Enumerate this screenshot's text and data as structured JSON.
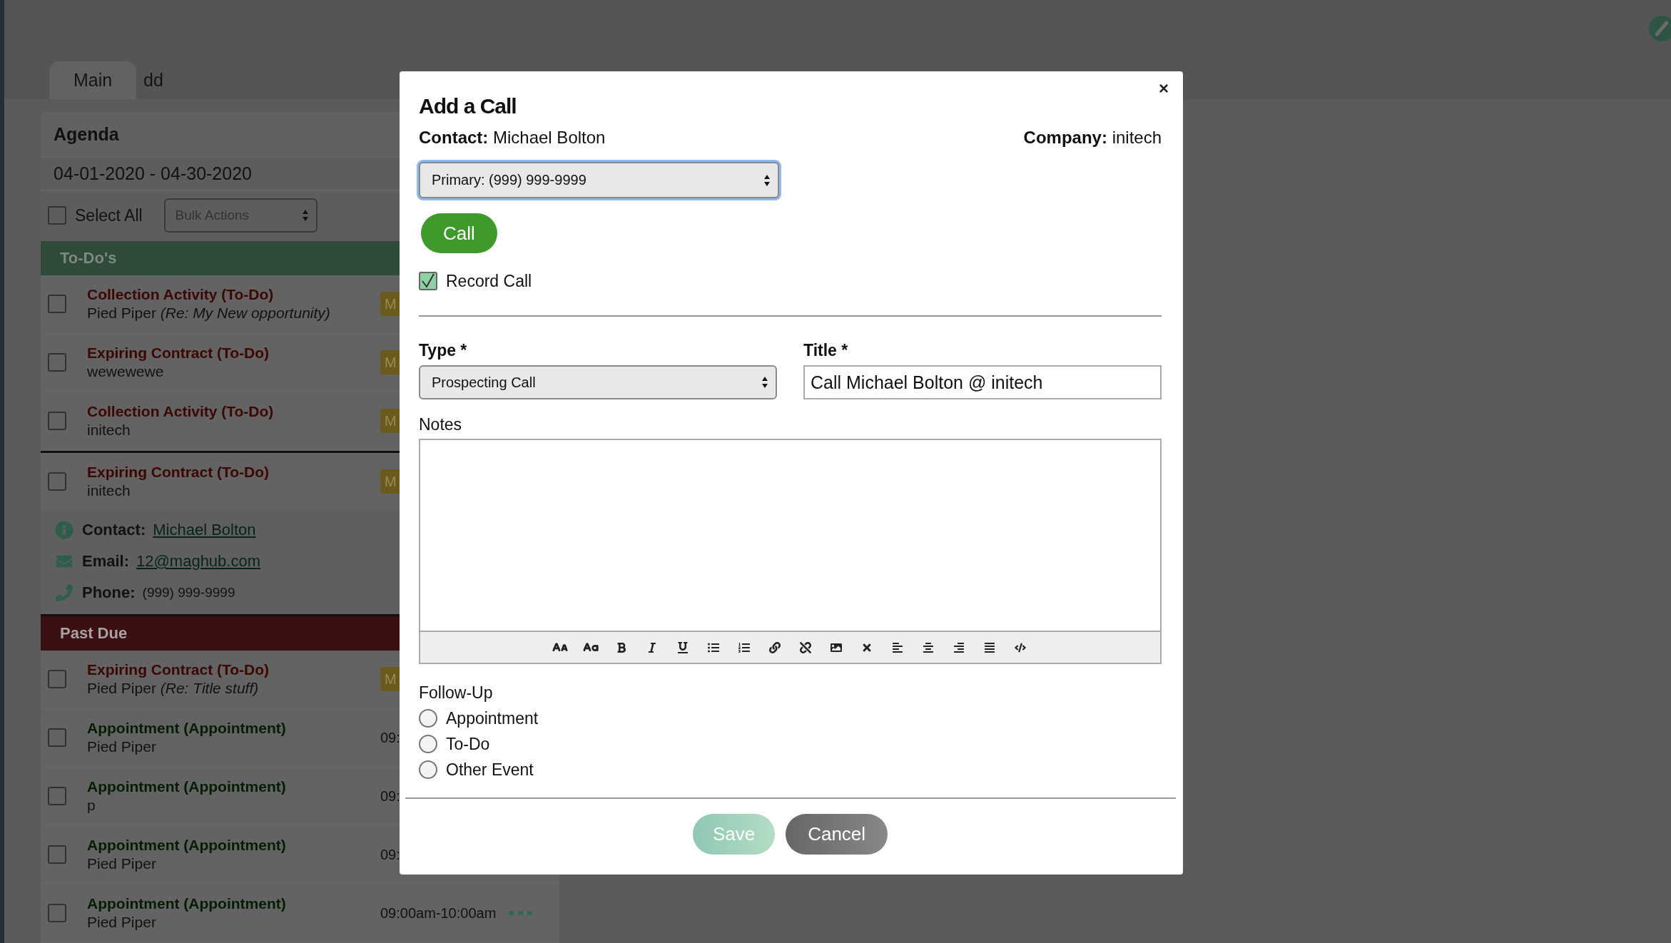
{
  "tabs": [
    {
      "label": "Main",
      "selected": true
    },
    {
      "label": "dd",
      "selected": false
    }
  ],
  "agenda": {
    "title": "Agenda",
    "date_range": "04-01-2020 - 04-30-2020",
    "select_all": {
      "label": "Select All",
      "checked": false
    },
    "bulk_actions": {
      "placeholder": "Bulk Actions"
    },
    "sections": [
      {
        "title": "To-Do's",
        "kind": "todo",
        "items": [
          {
            "title": "Collection Activity (To-Do)",
            "kind": "todo",
            "subtitle": "Pied Piper *(Re: My New opportunity)*",
            "checked": false,
            "expanded": false,
            "badge": "M"
          },
          {
            "title": "Expiring Contract (To-Do)",
            "kind": "todo",
            "subtitle": "wewewewe",
            "checked": false,
            "expanded": false,
            "badge": "M"
          },
          {
            "title": "Collection Activity (To-Do)",
            "kind": "todo",
            "subtitle": "initech",
            "checked": false,
            "expanded": false,
            "badge": "M"
          },
          {
            "title": "Expiring Contract (To-Do)",
            "kind": "todo",
            "subtitle": "initech",
            "checked": false,
            "expanded": true,
            "badge": "M",
            "details": [
              {
                "kind": "info",
                "label": "Contact:",
                "value": "Michael Bolton",
                "link": true
              },
              {
                "kind": "email",
                "label": "Email:",
                "value": "12@maghub.com",
                "link": true
              },
              {
                "kind": "phone",
                "label": "Phone:",
                "value": "(999) 999-9999",
                "link": false
              }
            ]
          }
        ]
      },
      {
        "title": "Past Due",
        "kind": "past_due",
        "items": [
          {
            "title": "Expiring Contract (To-Do)",
            "kind": "todo",
            "subtitle": "Pied Piper *(Re: Title stuff)*",
            "checked": false,
            "expanded": false,
            "badge": "M"
          },
          {
            "title": "Appointment (Appointment)",
            "kind": "appointment",
            "subtitle": "Pied Piper",
            "checked": false,
            "expanded": false,
            "time": "09:"
          },
          {
            "title": "Appointment (Appointment)",
            "kind": "appointment",
            "subtitle": "p",
            "checked": false,
            "expanded": false,
            "time": "09:"
          },
          {
            "title": "Appointment (Appointment)",
            "kind": "appointment",
            "subtitle": "Pied Piper",
            "checked": false,
            "expanded": false,
            "time": "09:"
          },
          {
            "title": "Appointment (Appointment)",
            "kind": "appointment",
            "subtitle": "Pied Piper",
            "checked": false,
            "expanded": false,
            "time": "09:00am-10:00am",
            "actions": true
          }
        ]
      }
    ]
  },
  "modal": {
    "title": "Add a Call",
    "close": "×",
    "contact": {
      "label": "Contact:",
      "value": "Michael Bolton"
    },
    "company": {
      "label": "Company:",
      "value": "initech"
    },
    "phone_select": {
      "value": "Primary: (999) 999-9999",
      "focused": true
    },
    "call_button": "Call",
    "record_call": {
      "label": "Record Call",
      "checked": true
    },
    "type": {
      "label": "Type *",
      "value": "Prospecting Call"
    },
    "title_field": {
      "label": "Title *",
      "value": "Call Michael Bolton @ initech"
    },
    "notes": {
      "label": "Notes"
    },
    "follow_up": {
      "label": "Follow-Up",
      "options": [
        {
          "label": "Appointment",
          "selected": false
        },
        {
          "label": "To-Do",
          "selected": false
        },
        {
          "label": "Other Event",
          "selected": false
        }
      ]
    },
    "buttons": [
      {
        "label": "Save",
        "kind": "save",
        "disabled": true
      },
      {
        "label": "Cancel",
        "kind": "cancel",
        "disabled": false
      }
    ]
  }
}
